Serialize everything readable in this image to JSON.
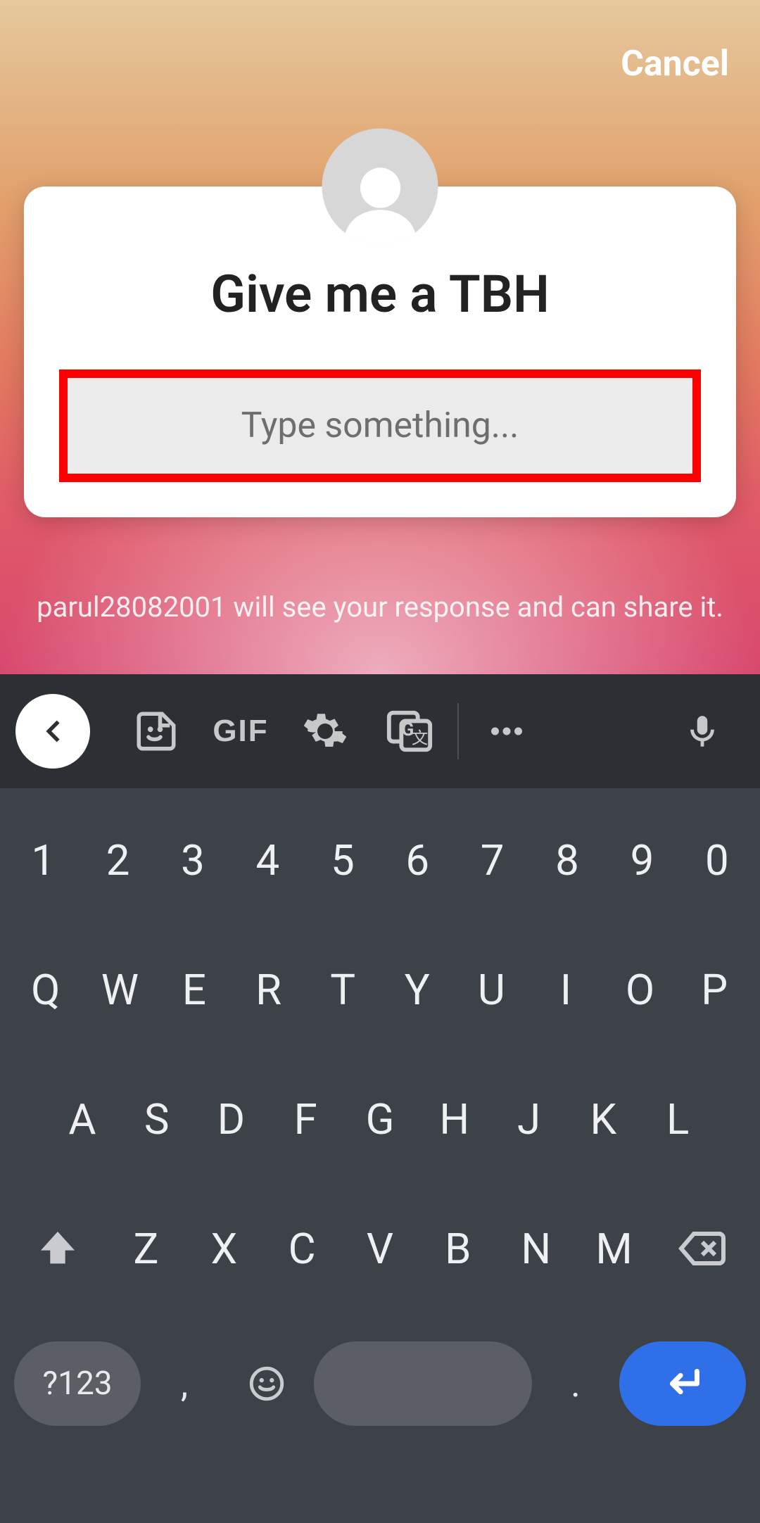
{
  "header": {
    "cancel_label": "Cancel"
  },
  "question_sticker": {
    "prompt": "Give me a TBH",
    "input_placeholder": "Type something...",
    "avatar_icon": "person-silhouette-icon",
    "highlight_color": "#ff0000"
  },
  "footer": {
    "disclosure": "parul28082001 will see your response and can share it."
  },
  "keyboard": {
    "suggestion_bar": {
      "collapse_icon": "chevron-left-icon",
      "items": [
        "sticker-icon",
        "gif-label",
        "gear-icon",
        "translate-icon",
        "more-icon",
        "mic-icon"
      ],
      "gif_label": "GIF"
    },
    "rows": {
      "numbers": [
        "1",
        "2",
        "3",
        "4",
        "5",
        "6",
        "7",
        "8",
        "9",
        "0"
      ],
      "letters1": [
        "Q",
        "W",
        "E",
        "R",
        "T",
        "Y",
        "U",
        "I",
        "O",
        "P"
      ],
      "letters2": [
        "A",
        "S",
        "D",
        "F",
        "G",
        "H",
        "J",
        "K",
        "L"
      ],
      "letters3": [
        "Z",
        "X",
        "C",
        "V",
        "B",
        "N",
        "M"
      ],
      "bottom": {
        "symbols_label": "?123",
        "comma": ",",
        "period": "."
      }
    }
  }
}
